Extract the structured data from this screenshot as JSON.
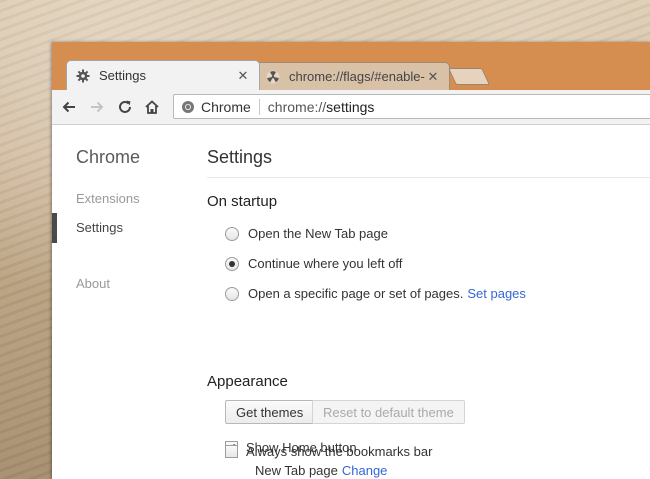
{
  "tabs": [
    {
      "title": "Settings",
      "icon": "gear-icon",
      "close": "✕"
    },
    {
      "title": "chrome://flags/#enable-",
      "icon": "radiation-icon",
      "close": "✕"
    }
  ],
  "omnibox": {
    "chip": "Chrome",
    "url_scheme": "chrome://",
    "url_path": "settings"
  },
  "sidebar": {
    "title": "Chrome",
    "items": [
      {
        "label": "Extensions"
      },
      {
        "label": "Settings"
      },
      {
        "label": "About"
      }
    ]
  },
  "main": {
    "title": "Settings",
    "startup": {
      "heading": "On startup",
      "options": [
        {
          "label": "Open the New Tab page",
          "checked": false
        },
        {
          "label": "Continue where you left off",
          "checked": true
        },
        {
          "label": "Open a specific page or set of pages.",
          "checked": false,
          "link": "Set pages"
        }
      ]
    },
    "appearance": {
      "heading": "Appearance",
      "get_themes": "Get themes",
      "reset_theme": "Reset to default theme",
      "show_home": {
        "label": "Show Home button",
        "checked": true
      },
      "home_page": {
        "text": "New Tab page",
        "link": "Change"
      },
      "bookmarks_bar": {
        "label": "Always show the bookmarks bar",
        "checked": false
      }
    }
  },
  "colors": {
    "frame": "#d58e4f",
    "link": "#3367d6"
  }
}
